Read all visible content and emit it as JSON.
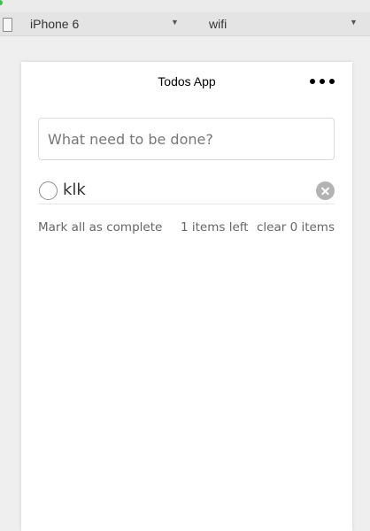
{
  "toolbar": {
    "device_label": "iPhone 6",
    "network_label": "wifi",
    "dropdown_icon": "triangle-down-icon"
  },
  "app": {
    "title": "Todos App",
    "menu_icon": "more-dots-icon",
    "input": {
      "placeholder": "What need to be done?",
      "value": ""
    },
    "todos": [
      {
        "text": "klk",
        "completed": false
      }
    ],
    "footer": {
      "mark_all": "Mark all as complete",
      "items_left": "1 items left",
      "clear": "clear 0 items"
    }
  }
}
